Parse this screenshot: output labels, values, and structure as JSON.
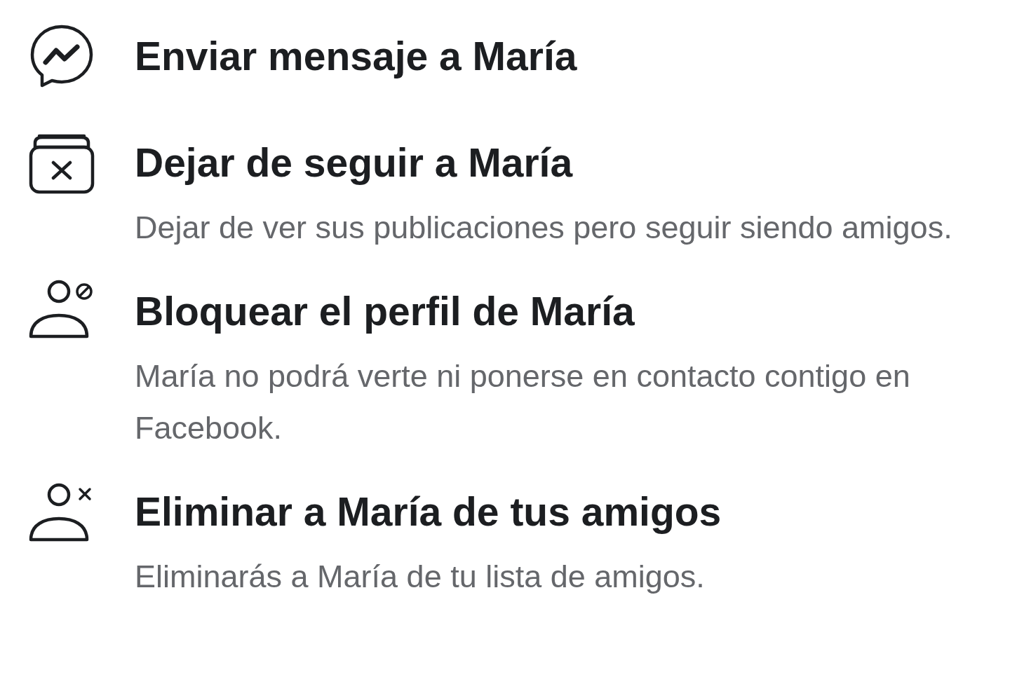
{
  "menu": {
    "items": [
      {
        "kind": "message",
        "title": "Enviar mensaje a María"
      },
      {
        "kind": "unfollow",
        "title": "Dejar de seguir a María",
        "description": "Dejar de ver sus publicaciones pero seguir siendo amigos."
      },
      {
        "kind": "block",
        "title": "Bloquear el perfil de María",
        "description": "María no podrá verte ni ponerse en contacto contigo en Facebook."
      },
      {
        "kind": "unfriend",
        "title": "Eliminar a María de tus amigos",
        "description": "Eliminarás a María de tu lista de amigos."
      }
    ]
  }
}
